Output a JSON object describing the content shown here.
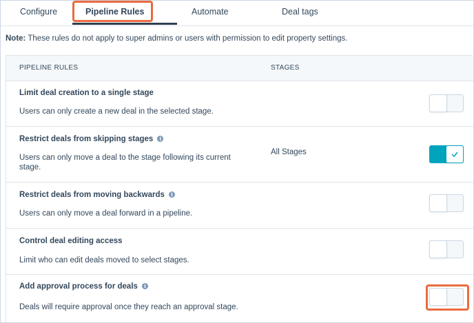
{
  "tabs": [
    {
      "label": "Configure",
      "active": false
    },
    {
      "label": "Pipeline Rules",
      "active": true
    },
    {
      "label": "Automate",
      "active": false
    },
    {
      "label": "Deal tags",
      "active": false
    }
  ],
  "note": {
    "prefix": "Note:",
    "text": " These rules do not apply to super admins or users with permission to edit property settings."
  },
  "table": {
    "headers": {
      "rules": "PIPELINE RULES",
      "stages": "STAGES"
    },
    "rows": [
      {
        "title": "Limit deal creation to a single stage",
        "info_icon": false,
        "desc": "Users can only create a new deal in the selected stage.",
        "stage": "",
        "enabled": false
      },
      {
        "title": "Restrict deals from skipping stages",
        "info_icon": true,
        "desc": "Users can only move a deal to the stage following its current stage.",
        "stage": "All Stages",
        "enabled": true
      },
      {
        "title": "Restrict deals from moving backwards",
        "info_icon": true,
        "desc": "Users can only move a deal forward in a pipeline.",
        "stage": "",
        "enabled": false
      },
      {
        "title": "Control deal editing access",
        "info_icon": false,
        "desc": "Limit who can edit deals moved to select stages.",
        "stage": "",
        "enabled": false
      },
      {
        "title": "Add approval process for deals",
        "info_icon": true,
        "desc": "Deals will require approval once they reach an approval stage.",
        "stage": "",
        "enabled": false
      }
    ]
  },
  "icons": {
    "info": "info-icon",
    "check": "check-icon"
  },
  "colors": {
    "toggle_on": "#00a4bd",
    "highlight": "#ea6a3f",
    "text": "#33475b",
    "header_bg": "#f5f8fa"
  }
}
